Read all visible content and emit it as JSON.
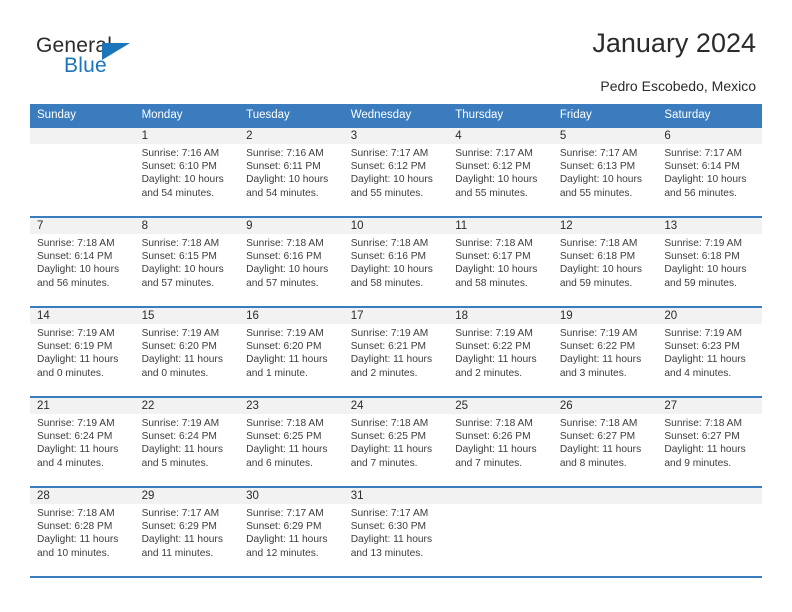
{
  "brand": {
    "name_top": "General",
    "name_bottom": "Blue",
    "accent_color": "#1a75bb"
  },
  "header": {
    "title": "January 2024",
    "subtitle": "Pedro Escobedo, Mexico",
    "header_bg_color": "#3a7cbe",
    "daynum_bg_color": "#f2f2f2"
  },
  "weekday_headers": [
    "Sunday",
    "Monday",
    "Tuesday",
    "Wednesday",
    "Thursday",
    "Friday",
    "Saturday"
  ],
  "weeks": [
    [
      {
        "day": "",
        "sunrise": "",
        "sunset": "",
        "daylight_line1": "",
        "daylight_line2": ""
      },
      {
        "day": "1",
        "sunrise": "Sunrise: 7:16 AM",
        "sunset": "Sunset: 6:10 PM",
        "daylight_line1": "Daylight: 10 hours",
        "daylight_line2": "and 54 minutes."
      },
      {
        "day": "2",
        "sunrise": "Sunrise: 7:16 AM",
        "sunset": "Sunset: 6:11 PM",
        "daylight_line1": "Daylight: 10 hours",
        "daylight_line2": "and 54 minutes."
      },
      {
        "day": "3",
        "sunrise": "Sunrise: 7:17 AM",
        "sunset": "Sunset: 6:12 PM",
        "daylight_line1": "Daylight: 10 hours",
        "daylight_line2": "and 55 minutes."
      },
      {
        "day": "4",
        "sunrise": "Sunrise: 7:17 AM",
        "sunset": "Sunset: 6:12 PM",
        "daylight_line1": "Daylight: 10 hours",
        "daylight_line2": "and 55 minutes."
      },
      {
        "day": "5",
        "sunrise": "Sunrise: 7:17 AM",
        "sunset": "Sunset: 6:13 PM",
        "daylight_line1": "Daylight: 10 hours",
        "daylight_line2": "and 55 minutes."
      },
      {
        "day": "6",
        "sunrise": "Sunrise: 7:17 AM",
        "sunset": "Sunset: 6:14 PM",
        "daylight_line1": "Daylight: 10 hours",
        "daylight_line2": "and 56 minutes."
      }
    ],
    [
      {
        "day": "7",
        "sunrise": "Sunrise: 7:18 AM",
        "sunset": "Sunset: 6:14 PM",
        "daylight_line1": "Daylight: 10 hours",
        "daylight_line2": "and 56 minutes."
      },
      {
        "day": "8",
        "sunrise": "Sunrise: 7:18 AM",
        "sunset": "Sunset: 6:15 PM",
        "daylight_line1": "Daylight: 10 hours",
        "daylight_line2": "and 57 minutes."
      },
      {
        "day": "9",
        "sunrise": "Sunrise: 7:18 AM",
        "sunset": "Sunset: 6:16 PM",
        "daylight_line1": "Daylight: 10 hours",
        "daylight_line2": "and 57 minutes."
      },
      {
        "day": "10",
        "sunrise": "Sunrise: 7:18 AM",
        "sunset": "Sunset: 6:16 PM",
        "daylight_line1": "Daylight: 10 hours",
        "daylight_line2": "and 58 minutes."
      },
      {
        "day": "11",
        "sunrise": "Sunrise: 7:18 AM",
        "sunset": "Sunset: 6:17 PM",
        "daylight_line1": "Daylight: 10 hours",
        "daylight_line2": "and 58 minutes."
      },
      {
        "day": "12",
        "sunrise": "Sunrise: 7:18 AM",
        "sunset": "Sunset: 6:18 PM",
        "daylight_line1": "Daylight: 10 hours",
        "daylight_line2": "and 59 minutes."
      },
      {
        "day": "13",
        "sunrise": "Sunrise: 7:19 AM",
        "sunset": "Sunset: 6:18 PM",
        "daylight_line1": "Daylight: 10 hours",
        "daylight_line2": "and 59 minutes."
      }
    ],
    [
      {
        "day": "14",
        "sunrise": "Sunrise: 7:19 AM",
        "sunset": "Sunset: 6:19 PM",
        "daylight_line1": "Daylight: 11 hours",
        "daylight_line2": "and 0 minutes."
      },
      {
        "day": "15",
        "sunrise": "Sunrise: 7:19 AM",
        "sunset": "Sunset: 6:20 PM",
        "daylight_line1": "Daylight: 11 hours",
        "daylight_line2": "and 0 minutes."
      },
      {
        "day": "16",
        "sunrise": "Sunrise: 7:19 AM",
        "sunset": "Sunset: 6:20 PM",
        "daylight_line1": "Daylight: 11 hours",
        "daylight_line2": "and 1 minute."
      },
      {
        "day": "17",
        "sunrise": "Sunrise: 7:19 AM",
        "sunset": "Sunset: 6:21 PM",
        "daylight_line1": "Daylight: 11 hours",
        "daylight_line2": "and 2 minutes."
      },
      {
        "day": "18",
        "sunrise": "Sunrise: 7:19 AM",
        "sunset": "Sunset: 6:22 PM",
        "daylight_line1": "Daylight: 11 hours",
        "daylight_line2": "and 2 minutes."
      },
      {
        "day": "19",
        "sunrise": "Sunrise: 7:19 AM",
        "sunset": "Sunset: 6:22 PM",
        "daylight_line1": "Daylight: 11 hours",
        "daylight_line2": "and 3 minutes."
      },
      {
        "day": "20",
        "sunrise": "Sunrise: 7:19 AM",
        "sunset": "Sunset: 6:23 PM",
        "daylight_line1": "Daylight: 11 hours",
        "daylight_line2": "and 4 minutes."
      }
    ],
    [
      {
        "day": "21",
        "sunrise": "Sunrise: 7:19 AM",
        "sunset": "Sunset: 6:24 PM",
        "daylight_line1": "Daylight: 11 hours",
        "daylight_line2": "and 4 minutes."
      },
      {
        "day": "22",
        "sunrise": "Sunrise: 7:19 AM",
        "sunset": "Sunset: 6:24 PM",
        "daylight_line1": "Daylight: 11 hours",
        "daylight_line2": "and 5 minutes."
      },
      {
        "day": "23",
        "sunrise": "Sunrise: 7:18 AM",
        "sunset": "Sunset: 6:25 PM",
        "daylight_line1": "Daylight: 11 hours",
        "daylight_line2": "and 6 minutes."
      },
      {
        "day": "24",
        "sunrise": "Sunrise: 7:18 AM",
        "sunset": "Sunset: 6:25 PM",
        "daylight_line1": "Daylight: 11 hours",
        "daylight_line2": "and 7 minutes."
      },
      {
        "day": "25",
        "sunrise": "Sunrise: 7:18 AM",
        "sunset": "Sunset: 6:26 PM",
        "daylight_line1": "Daylight: 11 hours",
        "daylight_line2": "and 7 minutes."
      },
      {
        "day": "26",
        "sunrise": "Sunrise: 7:18 AM",
        "sunset": "Sunset: 6:27 PM",
        "daylight_line1": "Daylight: 11 hours",
        "daylight_line2": "and 8 minutes."
      },
      {
        "day": "27",
        "sunrise": "Sunrise: 7:18 AM",
        "sunset": "Sunset: 6:27 PM",
        "daylight_line1": "Daylight: 11 hours",
        "daylight_line2": "and 9 minutes."
      }
    ],
    [
      {
        "day": "28",
        "sunrise": "Sunrise: 7:18 AM",
        "sunset": "Sunset: 6:28 PM",
        "daylight_line1": "Daylight: 11 hours",
        "daylight_line2": "and 10 minutes."
      },
      {
        "day": "29",
        "sunrise": "Sunrise: 7:17 AM",
        "sunset": "Sunset: 6:29 PM",
        "daylight_line1": "Daylight: 11 hours",
        "daylight_line2": "and 11 minutes."
      },
      {
        "day": "30",
        "sunrise": "Sunrise: 7:17 AM",
        "sunset": "Sunset: 6:29 PM",
        "daylight_line1": "Daylight: 11 hours",
        "daylight_line2": "and 12 minutes."
      },
      {
        "day": "31",
        "sunrise": "Sunrise: 7:17 AM",
        "sunset": "Sunset: 6:30 PM",
        "daylight_line1": "Daylight: 11 hours",
        "daylight_line2": "and 13 minutes."
      },
      {
        "day": "",
        "sunrise": "",
        "sunset": "",
        "daylight_line1": "",
        "daylight_line2": ""
      },
      {
        "day": "",
        "sunrise": "",
        "sunset": "",
        "daylight_line1": "",
        "daylight_line2": ""
      },
      {
        "day": "",
        "sunrise": "",
        "sunset": "",
        "daylight_line1": "",
        "daylight_line2": ""
      }
    ]
  ]
}
